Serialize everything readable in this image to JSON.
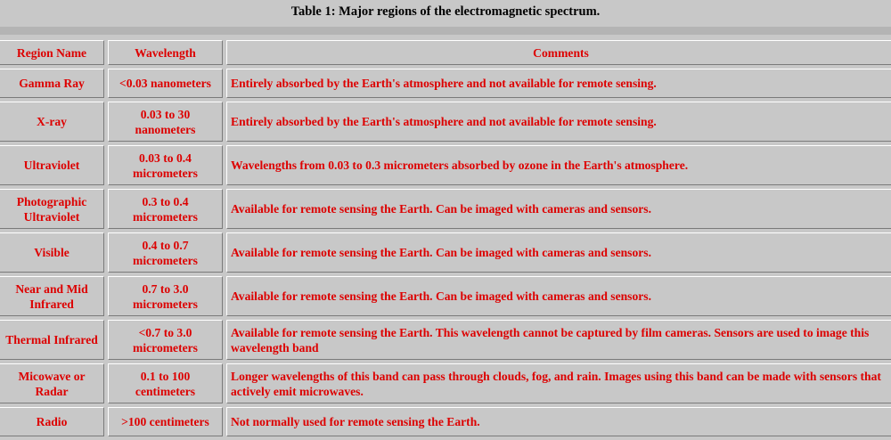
{
  "caption": "Table 1: Major regions of the electromagnetic spectrum.",
  "columns": [
    "Region Name",
    "Wavelength",
    "Comments"
  ],
  "rows": [
    {
      "region": "Gamma Ray",
      "wavelength": "<0.03 nanometers",
      "comments": "Entirely absorbed by the Earth's atmosphere and not available for remote sensing."
    },
    {
      "region": "X-ray",
      "wavelength": "0.03 to 30 nanometers",
      "comments": "Entirely absorbed by the Earth's atmosphere and not available for remote sensing."
    },
    {
      "region": "Ultraviolet",
      "wavelength": "0.03 to 0.4 micrometers",
      "comments": "Wavelengths from 0.03 to 0.3 micrometers absorbed by ozone in the Earth's atmosphere."
    },
    {
      "region": "Photographic Ultraviolet",
      "wavelength": "0.3 to 0.4 micrometers",
      "comments": "Available for remote sensing the Earth. Can be imaged with cameras and sensors."
    },
    {
      "region": "Visible",
      "wavelength": "0.4 to 0.7 micrometers",
      "comments": "Available for remote sensing the Earth. Can be imaged with cameras and sensors."
    },
    {
      "region": "Near and Mid Infrared",
      "wavelength": "0.7 to 3.0 micrometers",
      "comments": "Available for remote sensing the Earth. Can be imaged with cameras and sensors."
    },
    {
      "region": "Thermal Infrared",
      "wavelength": "<0.7 to 3.0 micrometers",
      "comments": "Available for remote sensing the Earth. This wavelength cannot be captured by film cameras. Sensors are used to image this wavelength band"
    },
    {
      "region": "Micowave or Radar",
      "wavelength": "0.1 to 100 centimeters",
      "comments": "Longer wavelengths of this band can pass through clouds, fog, and rain. Images using this band can be made with sensors that actively emit microwaves."
    },
    {
      "region": "Radio",
      "wavelength": ">100 centimeters",
      "comments": "Not normally used for remote sensing the Earth."
    }
  ],
  "colors": {
    "text": "#dd0000",
    "background": "#c8c8c8",
    "caption": "#000000"
  }
}
